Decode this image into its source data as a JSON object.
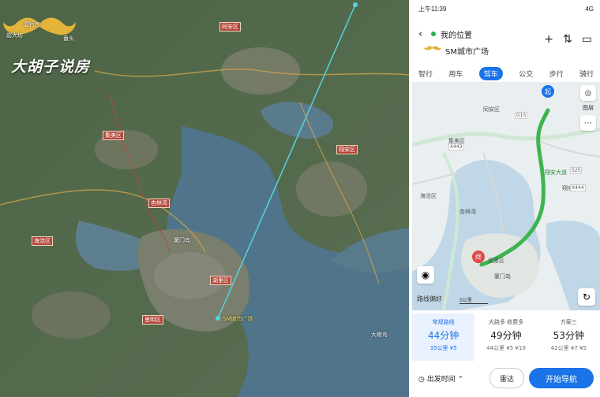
{
  "satellite": {
    "logo_small_top": "壹行房",
    "logo_corner_left": "前大坊",
    "logo_corner_right": "番头",
    "logo_text": "大胡子说房",
    "place_labels": [
      "同安区",
      "翔安区",
      "集美区",
      "海沧区",
      "思明区",
      "湖里区",
      "杏林湾",
      "厦门岛",
      "大嶝岛"
    ],
    "end_label": "SM城市广场"
  },
  "phone": {
    "status_time": "上午11:39",
    "status_right": "4G",
    "origin": "我的位置",
    "destination": "SM城市广场",
    "header_icons": [
      "add-icon",
      "swap-icon",
      "more-icon"
    ],
    "modes": [
      "智行",
      "用车",
      "驾车",
      "公交",
      "步行",
      "骑行"
    ],
    "active_mode": "驾车",
    "map_labels": [
      "同安区",
      "翔安区",
      "海沧区",
      "集美区",
      "湖里区",
      "厦门岛",
      "翔安大道",
      "杏林湾"
    ],
    "road_tags": [
      "G15",
      "X443",
      "S25",
      "X444"
    ],
    "tools": {
      "layers": "图层"
    },
    "route_note": "路线偏好",
    "scale_text": "5公里",
    "start_marker": "起",
    "end_marker": "终",
    "cards": [
      {
        "tag": "常规路线",
        "time": "44分钟",
        "sub": "35公里 ¥5"
      },
      {
        "tag": "大路多 收费多",
        "time": "49分钟",
        "sub": "44公里 ¥5 ¥10"
      },
      {
        "tag": "方案三",
        "time": "53分钟",
        "sub": "42公里 ¥7 ¥5"
      }
    ],
    "depart_label": "出发时间",
    "radar_label": "雷达",
    "nav_label": "开始导航",
    "colors": {
      "accent": "#1a73e8",
      "route": "#3cb550",
      "water": "#bfd7e6",
      "land": "#e9eef0"
    }
  }
}
